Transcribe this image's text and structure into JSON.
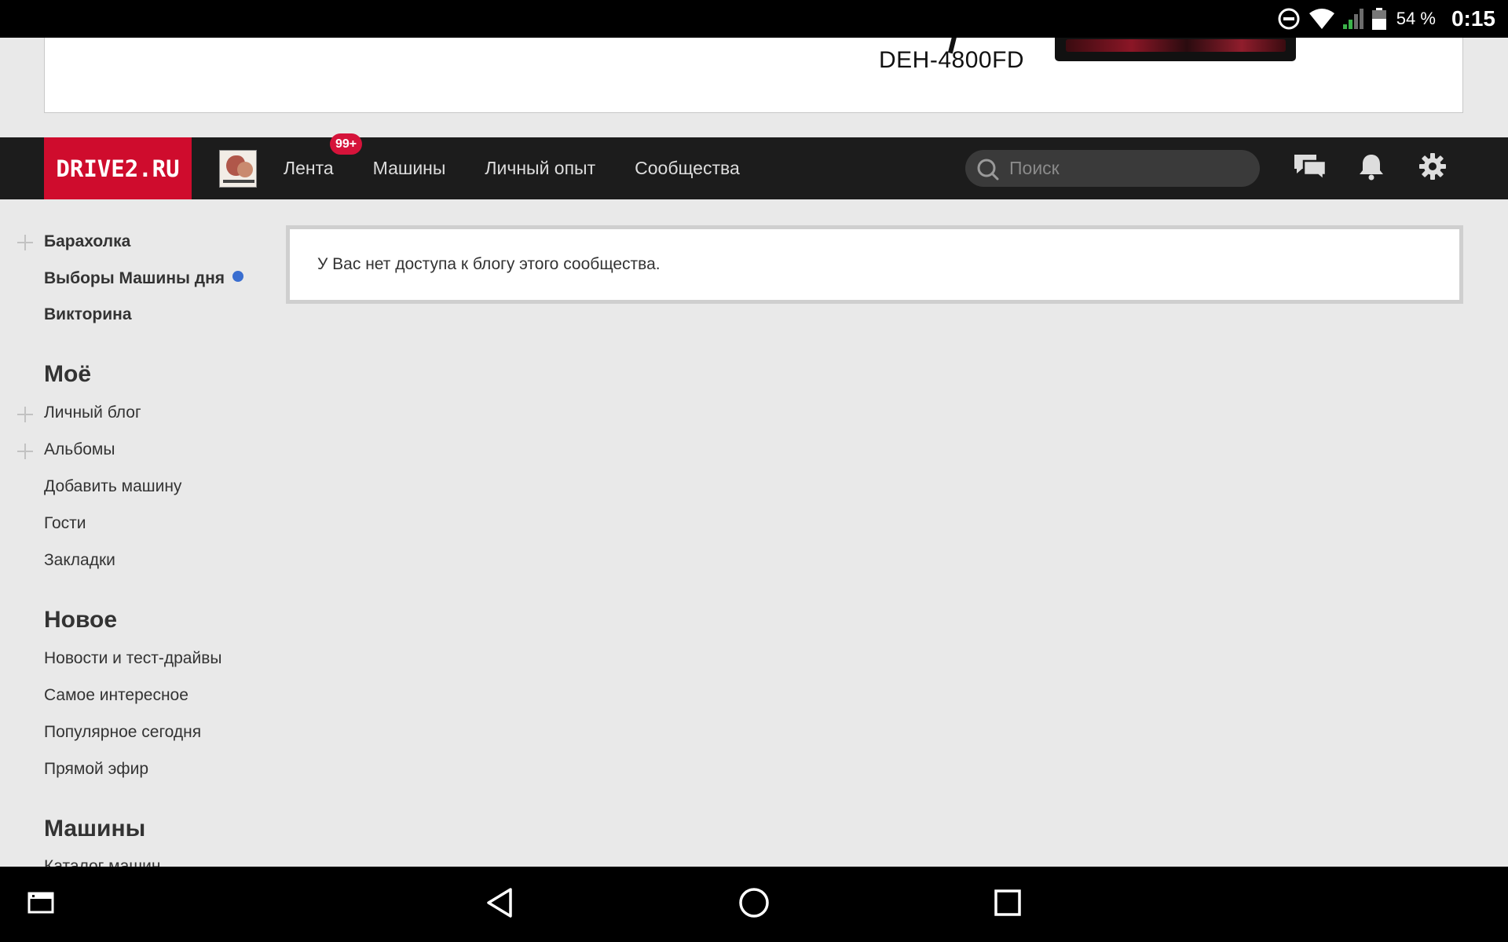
{
  "status_bar": {
    "battery_percent": "54 %",
    "time": "0:15",
    "icons": [
      "do-not-disturb-icon",
      "wifi-icon",
      "signal-icon",
      "battery-icon"
    ]
  },
  "ad": {
    "model": "DEH-4800FD"
  },
  "header": {
    "logo": "DRIVE2.RU",
    "nav": {
      "feed": "Лента",
      "feed_badge": "99+",
      "cars": "Машины",
      "experience": "Личный опыт",
      "communities": "Сообщества"
    },
    "search_placeholder": "Поиск",
    "icons": [
      "messages-icon",
      "bell-icon",
      "gear-icon"
    ],
    "accent_color": "#cf0c2d"
  },
  "sidebar": {
    "top_items": [
      {
        "label": "Барахолка"
      },
      {
        "label": "Выборы Машины дня"
      },
      {
        "label": "Викторина"
      }
    ],
    "sections": [
      {
        "title": "Моё",
        "items": [
          "Личный блог",
          "Альбомы",
          "Добавить машину",
          "Гости",
          "Закладки"
        ]
      },
      {
        "title": "Новое",
        "items": [
          "Новости и тест-драйвы",
          "Самое интересное",
          "Популярное сегодня",
          "Прямой эфир"
        ]
      },
      {
        "title": "Машины",
        "items": [
          "Каталог машин"
        ]
      }
    ]
  },
  "main": {
    "notice": "У Вас нет доступа к блогу этого сообщества."
  }
}
